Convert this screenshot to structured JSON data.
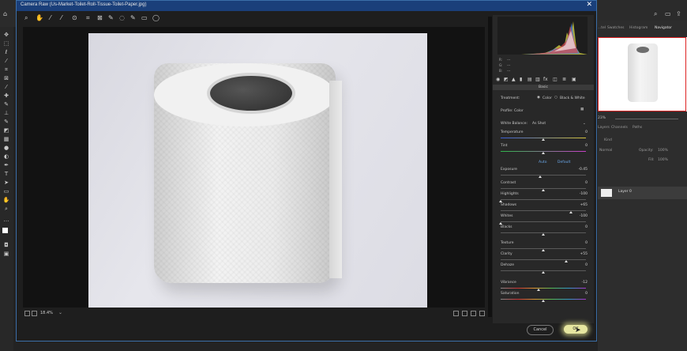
{
  "dialog": {
    "title": "Camera Raw (Us-Market-Toilet-Roll-Tissue-Toilet-Paper.jpg)",
    "close_glyph": "✕",
    "zoom_level": "18.4%",
    "cancel_label": "Cancel",
    "ok_label": "OK"
  },
  "histogram": {
    "r_label": "R:",
    "g_label": "G:",
    "b_label": "B:",
    "r_value": "---",
    "g_value": "---",
    "b_value": "---"
  },
  "basic": {
    "header": "Basic",
    "treatment_label": "Treatment:",
    "color_label": "Color",
    "bw_label": "Black & White",
    "profile_label": "Profile:",
    "profile_value": "Color",
    "wb_label": "White Balance:",
    "wb_value": "As Shot",
    "auto_label": "Auto",
    "default_label": "Default"
  },
  "sliders": [
    {
      "label": "Temperature",
      "value": "0",
      "pos": 0.5,
      "kind": "temp"
    },
    {
      "label": "Tint",
      "value": "0",
      "pos": 0.5,
      "kind": "tint"
    },
    {
      "label": "Exposure",
      "value": "-0.45",
      "pos": 0.46,
      "kind": ""
    },
    {
      "label": "Contrast",
      "value": "0",
      "pos": 0.5,
      "kind": ""
    },
    {
      "label": "Highlights",
      "value": "-100",
      "pos": 0.0,
      "kind": ""
    },
    {
      "label": "Shadows",
      "value": "+65",
      "pos": 0.82,
      "kind": ""
    },
    {
      "label": "Whites",
      "value": "-100",
      "pos": 0.0,
      "kind": ""
    },
    {
      "label": "Blacks",
      "value": "0",
      "pos": 0.5,
      "kind": ""
    },
    {
      "label": "Texture",
      "value": "0",
      "pos": 0.5,
      "kind": ""
    },
    {
      "label": "Clarity",
      "value": "+55",
      "pos": 0.77,
      "kind": ""
    },
    {
      "label": "Dehaze",
      "value": "0",
      "pos": 0.5,
      "kind": ""
    },
    {
      "label": "Vibrance",
      "value": "-12",
      "pos": 0.44,
      "kind": "vib"
    },
    {
      "label": "Saturation",
      "value": "0",
      "pos": 0.5,
      "kind": "sat"
    }
  ],
  "ps": {
    "tabs": [
      "...tel",
      "Swatches",
      "Histogram",
      "Navigator"
    ],
    "zoom_pct": "23%",
    "layer_tabs": [
      "Layers",
      "Channels",
      "Paths"
    ],
    "kind_label": "Kind",
    "blend_mode": "Normal",
    "opacity_label": "Opacity:",
    "opacity_value": "100%",
    "fill_label": "Fill:",
    "fill_value": "100%",
    "layer_name": "Layer 0"
  }
}
